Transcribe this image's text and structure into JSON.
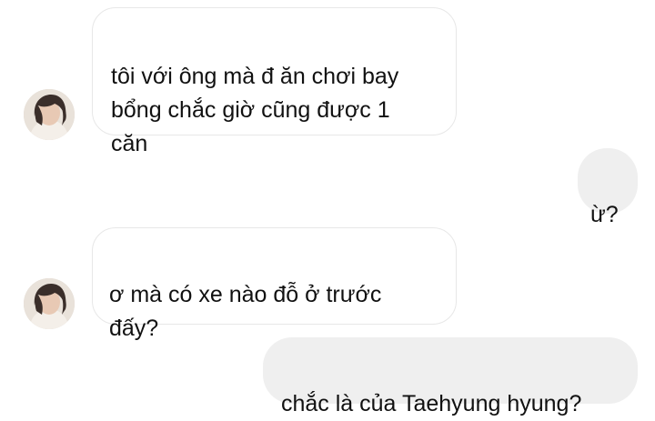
{
  "conversation": {
    "messages": [
      {
        "direction": "incoming",
        "text": "tôi với ông mà đ ăn chơi bay\nbổng chắc giờ cũng được 1\ncăn"
      },
      {
        "direction": "outgoing",
        "text": "ừ?"
      },
      {
        "direction": "incoming",
        "text": "ơ mà có xe nào đỗ ở trước\nđấy?"
      },
      {
        "direction": "outgoing",
        "text": "chắc là của Taehyung hyung?"
      }
    ]
  },
  "colors": {
    "incoming_bubble_bg": "#ffffff",
    "incoming_bubble_border": "#e7e7e7",
    "outgoing_bubble_bg": "#efefef",
    "text": "#111111"
  },
  "icons": {
    "avatar": "contact-avatar-photo"
  }
}
